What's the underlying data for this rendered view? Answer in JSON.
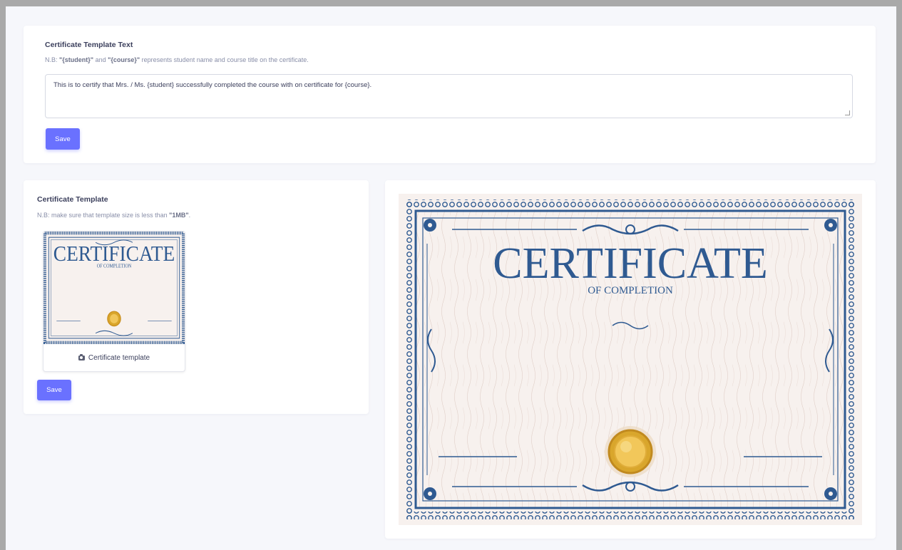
{
  "text_section": {
    "title": "Certificate Template Text",
    "note_prefix": "N.B: ",
    "note_student": "\"{student}\"",
    "note_and": " and ",
    "note_course": "\"{course}\"",
    "note_suffix": " represents student name and course title on the certificate.",
    "template_text": "This is to certify that Mrs. / Ms. {student} successfully completed the course with on certificate for {course}.",
    "save_label": "Save"
  },
  "template_section": {
    "title": "Certificate Template",
    "note_prefix": "N.B: make sure that template size is less than ",
    "note_size": "\"1MB\"",
    "note_suffix": ".",
    "thumbnail_caption": "Certificate template",
    "caption_icon": "camera-icon",
    "save_label": "Save"
  },
  "certificate": {
    "heading": "CERTIFICATE",
    "subheading": "OF COMPLETION"
  },
  "colors": {
    "accent": "#6a71ff",
    "certificate_blue": "#2f5a91",
    "certificate_bg": "#f7f1ee",
    "seal_gold": "#d9a62c"
  }
}
